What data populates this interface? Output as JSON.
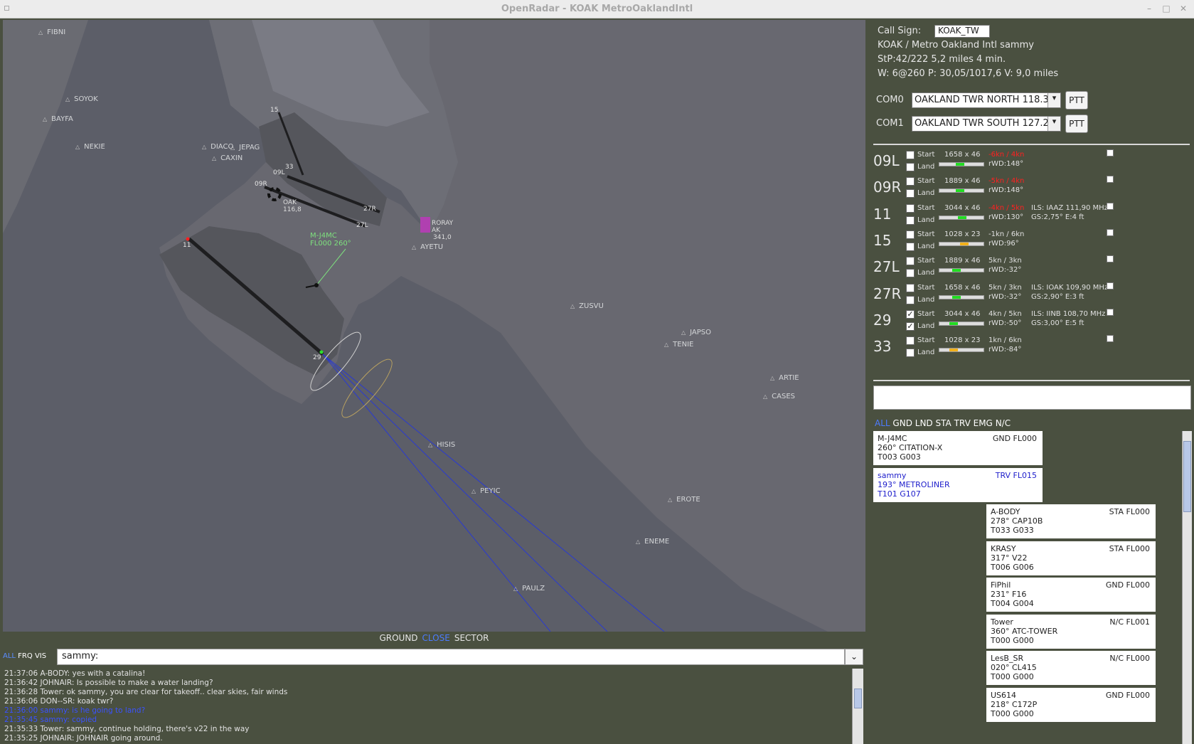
{
  "window": {
    "title": "OpenRadar - KOAK MetroOaklandIntl",
    "min": "–",
    "max": "□",
    "close": "✕"
  },
  "radar": {
    "fixes": [
      {
        "name": "FIBNI"
      },
      {
        "name": "SOYOK"
      },
      {
        "name": "BAYFA"
      },
      {
        "name": "NEKIE"
      },
      {
        "name": "DIACO"
      },
      {
        "name": "JEPAG"
      },
      {
        "name": "CAXIN"
      },
      {
        "name": "AYETU"
      },
      {
        "name": "ZUSVU"
      },
      {
        "name": "JAPSO"
      },
      {
        "name": "TENIE"
      },
      {
        "name": "ARTIE"
      },
      {
        "name": "CASES"
      },
      {
        "name": "HISIS"
      },
      {
        "name": "PEYIC"
      },
      {
        "name": "EROTE"
      },
      {
        "name": "ENEME"
      },
      {
        "name": "PAULZ"
      }
    ],
    "runway_labels": [
      "15",
      "33",
      "09L",
      "09R",
      "27R",
      "27L",
      "11",
      "29"
    ],
    "navaid": {
      "name": "OAK",
      "freq": "116,8"
    },
    "pink_navaid": {
      "name": "RORAY",
      "code": "AK",
      "freq": "341,0"
    },
    "aircraft": {
      "callsign": "M-J4MC",
      "level": "FL000 260°"
    },
    "modes": {
      "ground": "GROUND",
      "close": "CLOSE",
      "sector": "SECTOR"
    }
  },
  "chat": {
    "filters": {
      "all": "ALL",
      "frq": "FRQ",
      "vis": "VIS"
    },
    "input_value": "sammy:",
    "dropdown": "⌄",
    "messages": [
      {
        "text": "21:37:06 A-BODY:  yes with a catalina!",
        "mine": false
      },
      {
        "text": "21:36:42 JOHNAIR:  Is possible to make a water landing?",
        "mine": false
      },
      {
        "text": "21:36:28 Tower:  ok sammy, you are clear for takeoff..  clear skies, fair winds",
        "mine": false
      },
      {
        "text": "21:36:06 DON--SR:  koak twr?",
        "mine": false
      },
      {
        "text": "21:36:00  sammy:  is he going to land?",
        "mine": true
      },
      {
        "text": "21:35:45  sammy:  copied",
        "mine": true
      },
      {
        "text": "21:35:33 Tower:  sammy, continue holding, there's  v22 in the way",
        "mine": false
      },
      {
        "text": "21:35:25 JOHNAIR:  JOHNAIR going around.",
        "mine": false
      }
    ]
  },
  "panel": {
    "callsign_label": "Call Sign:",
    "callsign_value": "KOAK_TW",
    "airport": "KOAK / Metro Oakland Intl      sammy",
    "stp": "StP:42/222 5,2 miles 4 min.",
    "weather": " W: 6@260  P: 30,05/1017,6  V: 9,0 miles",
    "com0": {
      "label": "COM0",
      "value": "OAKLAND TWR NORTH  118.30",
      "ptt": "PTT"
    },
    "com1": {
      "label": "COM1",
      "value": "OAKLAND TWR SOUTH  127.20",
      "ptt": "PTT"
    },
    "start_label": "Start",
    "land_label": "Land",
    "runways": [
      {
        "id": "09L",
        "dim": "1658 x 46",
        "wind": "-6kn / 4kn",
        "wind_alert": true,
        "rwd": "rWD:148°",
        "ils": "",
        "gs": "",
        "start": false,
        "land": false,
        "bar_color": "#22dd22",
        "bar_pos": 0.5
      },
      {
        "id": "09R",
        "dim": "1889 x 46",
        "wind": "-5kn / 4kn",
        "wind_alert": true,
        "rwd": "rWD:148°",
        "ils": "",
        "gs": "",
        "start": false,
        "land": false,
        "bar_color": "#22dd22",
        "bar_pos": 0.5
      },
      {
        "id": "11",
        "dim": "3044 x 46",
        "wind": "-4kn / 5kn",
        "wind_alert": true,
        "rwd": "rWD:130°",
        "ils": "ILS: IAAZ 111,90 MHz",
        "gs": "GS:2,75° E:4 ft",
        "start": false,
        "land": false,
        "bar_color": "#22dd22",
        "bar_pos": 0.55
      },
      {
        "id": "15",
        "dim": "1028 x 23",
        "wind": "-1kn / 6kn",
        "wind_alert": false,
        "rwd": "rWD:96°",
        "ils": "",
        "gs": "",
        "start": false,
        "land": false,
        "bar_color": "#f2b21c",
        "bar_pos": 0.6
      },
      {
        "id": "27L",
        "dim": "1889 x 46",
        "wind": "5kn / 3kn",
        "wind_alert": false,
        "rwd": "rWD:-32°",
        "ils": "",
        "gs": "",
        "start": false,
        "land": false,
        "bar_color": "#22dd22",
        "bar_pos": 0.42
      },
      {
        "id": "27R",
        "dim": "1658 x 46",
        "wind": "5kn / 3kn",
        "wind_alert": false,
        "rwd": "rWD:-32°",
        "ils": "ILS: IOAK 109,90 MHz",
        "gs": "GS:2,90° E:3 ft",
        "start": false,
        "land": false,
        "bar_color": "#22dd22",
        "bar_pos": 0.42
      },
      {
        "id": "29",
        "dim": "3044 x 46",
        "wind": "4kn / 5kn",
        "wind_alert": false,
        "rwd": "rWD:-50°",
        "ils": "ILS: IINB 108,70 MHz",
        "gs": "GS:3,00° E:5 ft",
        "start": true,
        "land": true,
        "bar_color": "#22dd22",
        "bar_pos": 0.35
      },
      {
        "id": "33",
        "dim": "1028 x 23",
        "wind": "1kn / 6kn",
        "wind_alert": false,
        "rwd": "rWD:-84°",
        "ils": "",
        "gs": "",
        "start": false,
        "land": false,
        "bar_color": "#f2b21c",
        "bar_pos": 0.35
      }
    ],
    "strip_filters": {
      "all": "ALL",
      "gnd": "GND",
      "lnd": "LND",
      "sta": "STA",
      "trv": "TRV",
      "emg": "EMG",
      "nc": "N/C"
    },
    "strips": [
      {
        "callsign": "M-J4MC",
        "status": "GND  FL000",
        "line2": "260°  CITATION-X",
        "line3": "T003  G003",
        "blue": false,
        "col": 0
      },
      {
        "callsign": "sammy",
        "status": "TRV   FL015",
        "line2": "193°  METROLINER",
        "line3": "T101  G107",
        "blue": true,
        "col": 0
      },
      {
        "callsign": "A-BODY",
        "status": "STA   FL000",
        "line2": "278°  CAP10B",
        "line3": "T033  G033",
        "blue": false,
        "col": 1
      },
      {
        "callsign": "KRASY",
        "status": "STA   FL000",
        "line2": "317°  V22",
        "line3": "T006  G006",
        "blue": false,
        "col": 1
      },
      {
        "callsign": "FiPhil",
        "status": "GND   FL000",
        "line2": "231°  F16",
        "line3": "T004  G004",
        "blue": false,
        "col": 1
      },
      {
        "callsign": "Tower",
        "status": "N/C   FL001",
        "line2": "360°  ATC-TOWER",
        "line3": "T000  G000",
        "blue": false,
        "col": 1
      },
      {
        "callsign": "LesB_SR",
        "status": "N/C   FL000",
        "line2": "020°  CL415",
        "line3": "T000  G000",
        "blue": false,
        "col": 1
      },
      {
        "callsign": "US614",
        "status": "GND   FL000",
        "line2": "218°  C172P",
        "line3": "T000  G000",
        "blue": false,
        "col": 1
      }
    ]
  }
}
